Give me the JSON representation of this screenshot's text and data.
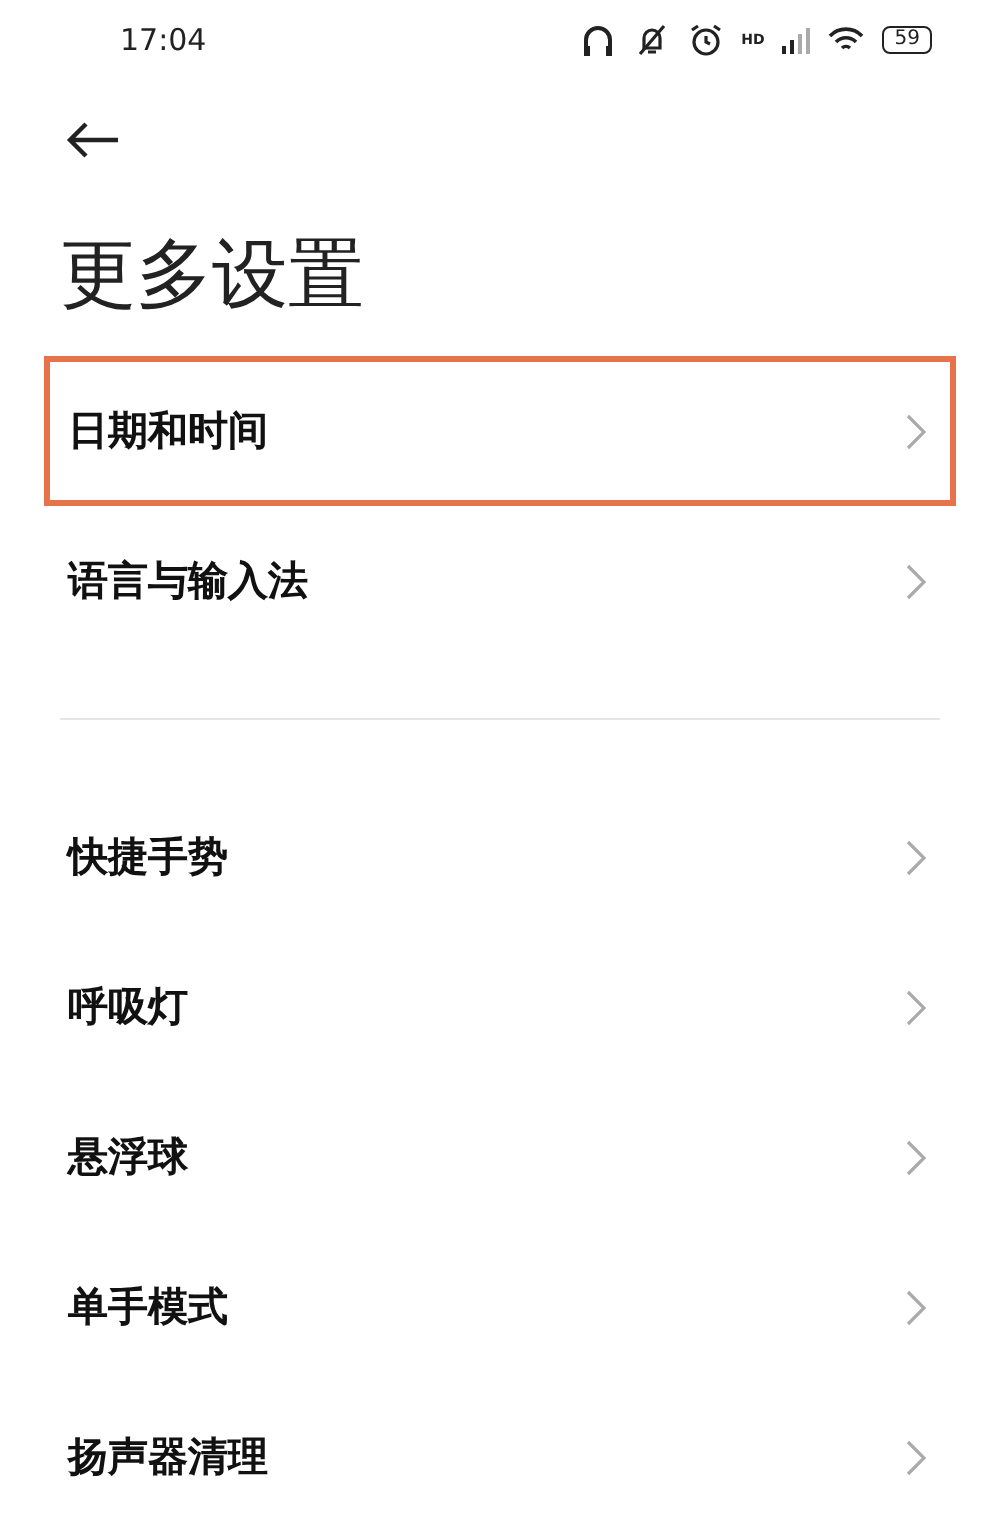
{
  "status_bar": {
    "time": "17:04",
    "signal_label": "HD",
    "battery": "59"
  },
  "title": "更多设置",
  "groups": [
    {
      "items": [
        {
          "label": "日期和时间",
          "highlighted": true
        },
        {
          "label": "语言与输入法",
          "highlighted": false
        }
      ]
    },
    {
      "items": [
        {
          "label": "快捷手势",
          "highlighted": false
        },
        {
          "label": "呼吸灯",
          "highlighted": false
        },
        {
          "label": "悬浮球",
          "highlighted": false
        },
        {
          "label": "单手模式",
          "highlighted": false
        },
        {
          "label": "扬声器清理",
          "highlighted": false
        }
      ]
    }
  ]
}
